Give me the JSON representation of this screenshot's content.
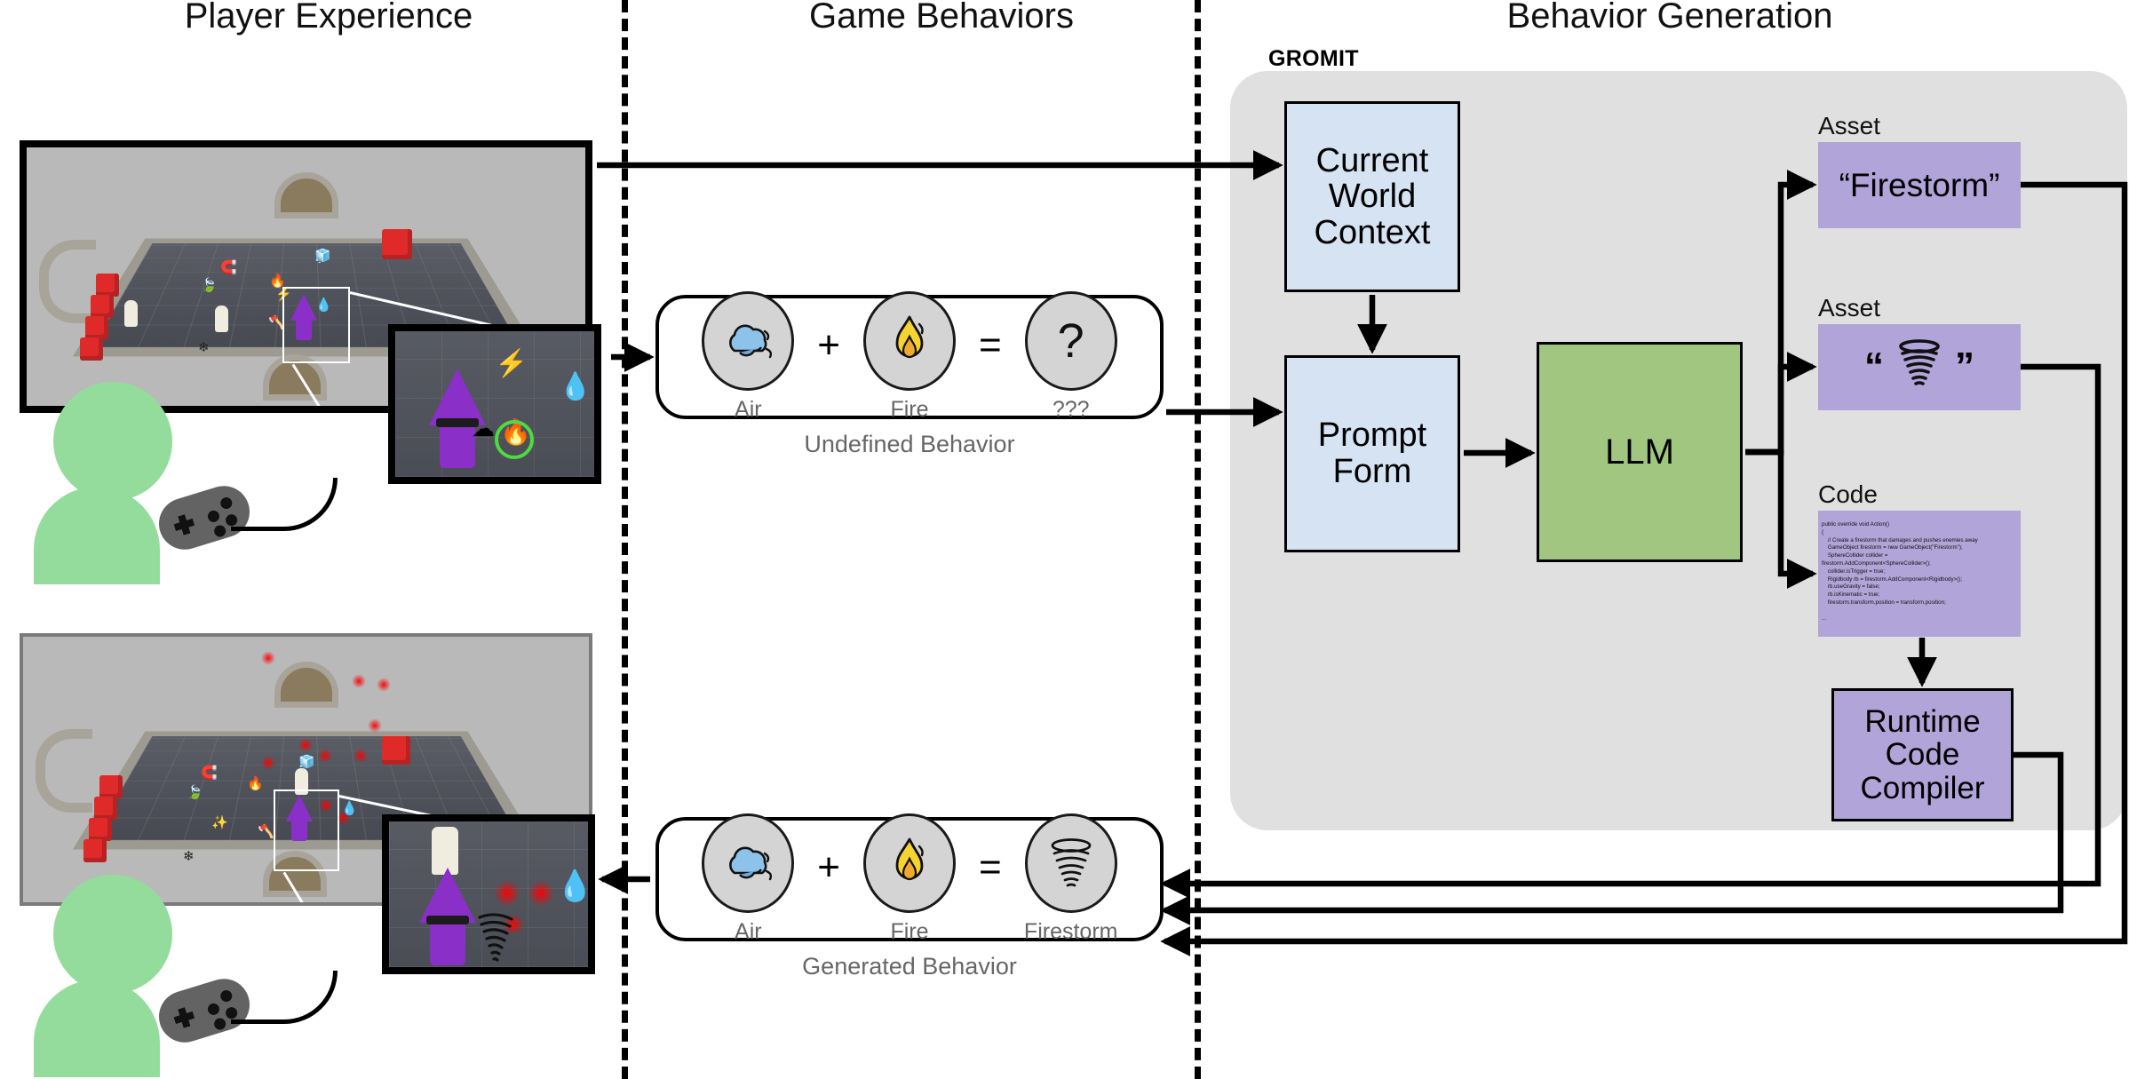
{
  "columns": {
    "player_experience": "Player Experience",
    "game_behaviors": "Game Behaviors",
    "behavior_generation": "Behavior Generation"
  },
  "system": {
    "name": "GROMIT"
  },
  "pipeline": {
    "current_world_context": "Current World Context",
    "prompt_form": "Prompt Form",
    "llm": "LLM",
    "runtime_code_compiler": "Runtime Code Compiler"
  },
  "outputs": {
    "asset_caption_1": "Asset",
    "asset_name": "“Firestorm”",
    "asset_caption_2": "Asset",
    "asset_quote_open": "“",
    "asset_quote_close": "”",
    "asset_icon": "tornado-icon",
    "code_caption": "Code",
    "code_text": "public override void Action()\n{\n    // Create a firestorm that damages and pushes enemies away\n    GameObject firestorm = new GameObject(\"Firestorm\");\n    SphereCollider collider =\nfirestorm.AddComponent<SphereCollider>();\n    collider.isTrigger = true;\n    Rigidbody rb = firestorm.AddComponent<Rigidbody>();\n    rb.useGravity = false;\n    rb.isKinematic = true;\n    firestorm.transform.position = transform.position;\n\n..."
  },
  "recipes": [
    {
      "id": "undefined",
      "caption": "Undefined Behavior",
      "slots": [
        {
          "label": "Air",
          "icon": "cloud-icon"
        },
        {
          "label": "Fire",
          "icon": "flame-icon"
        },
        {
          "label": "???",
          "icon": "question-mark-icon"
        }
      ],
      "operators": [
        "+",
        "="
      ]
    },
    {
      "id": "generated",
      "caption": "Generated Behavior",
      "slots": [
        {
          "label": "Air",
          "icon": "cloud-icon"
        },
        {
          "label": "Fire",
          "icon": "flame-icon"
        },
        {
          "label": "Firestorm",
          "icon": "tornado-icon"
        }
      ],
      "operators": [
        "+",
        "="
      ]
    }
  ],
  "screenshots": [
    {
      "id": "gameplay-before",
      "alt": "dungeon room with wizard, skeletons and element pickups"
    },
    {
      "id": "gameplay-after",
      "alt": "dungeon room with firestorm effect damaging skeleton"
    }
  ],
  "insets": [
    {
      "id": "inset-before",
      "alt": "close-up of wizard holding air and fire elements"
    },
    {
      "id": "inset-after",
      "alt": "close-up of wizard casting firestorm at skeleton"
    }
  ],
  "player": {
    "avatar": "player-avatar",
    "controller": "gamepad-icon"
  },
  "colors": {
    "context_blue": "#d6e3f3",
    "llm_green": "#a0c680",
    "asset_purple": "#b0a4d8",
    "panel_gray": "#e0e0e0",
    "player_green": "#94dc9c",
    "flame_yellow": "#f5d431",
    "air_blue": "#8dc3ea",
    "highlight_green": "#4ddb3f",
    "enemy_red": "#e02a2a"
  }
}
